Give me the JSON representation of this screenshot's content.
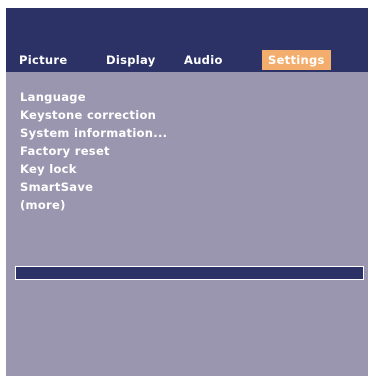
{
  "tabs": [
    {
      "label": "Picture",
      "active": false
    },
    {
      "label": "Display",
      "active": false
    },
    {
      "label": "Audio",
      "active": false
    },
    {
      "label": "Settings",
      "active": true
    }
  ],
  "menu": {
    "items": [
      "Language",
      "Keystone correction",
      "System information...",
      "Factory reset",
      "Key lock",
      "SmartSave",
      "(more)"
    ]
  },
  "progress": {
    "value": 0
  },
  "colors": {
    "header": "#2c3166",
    "body": "#9b96b0",
    "accent": "#f3ad6c",
    "text": "#ffffff"
  }
}
